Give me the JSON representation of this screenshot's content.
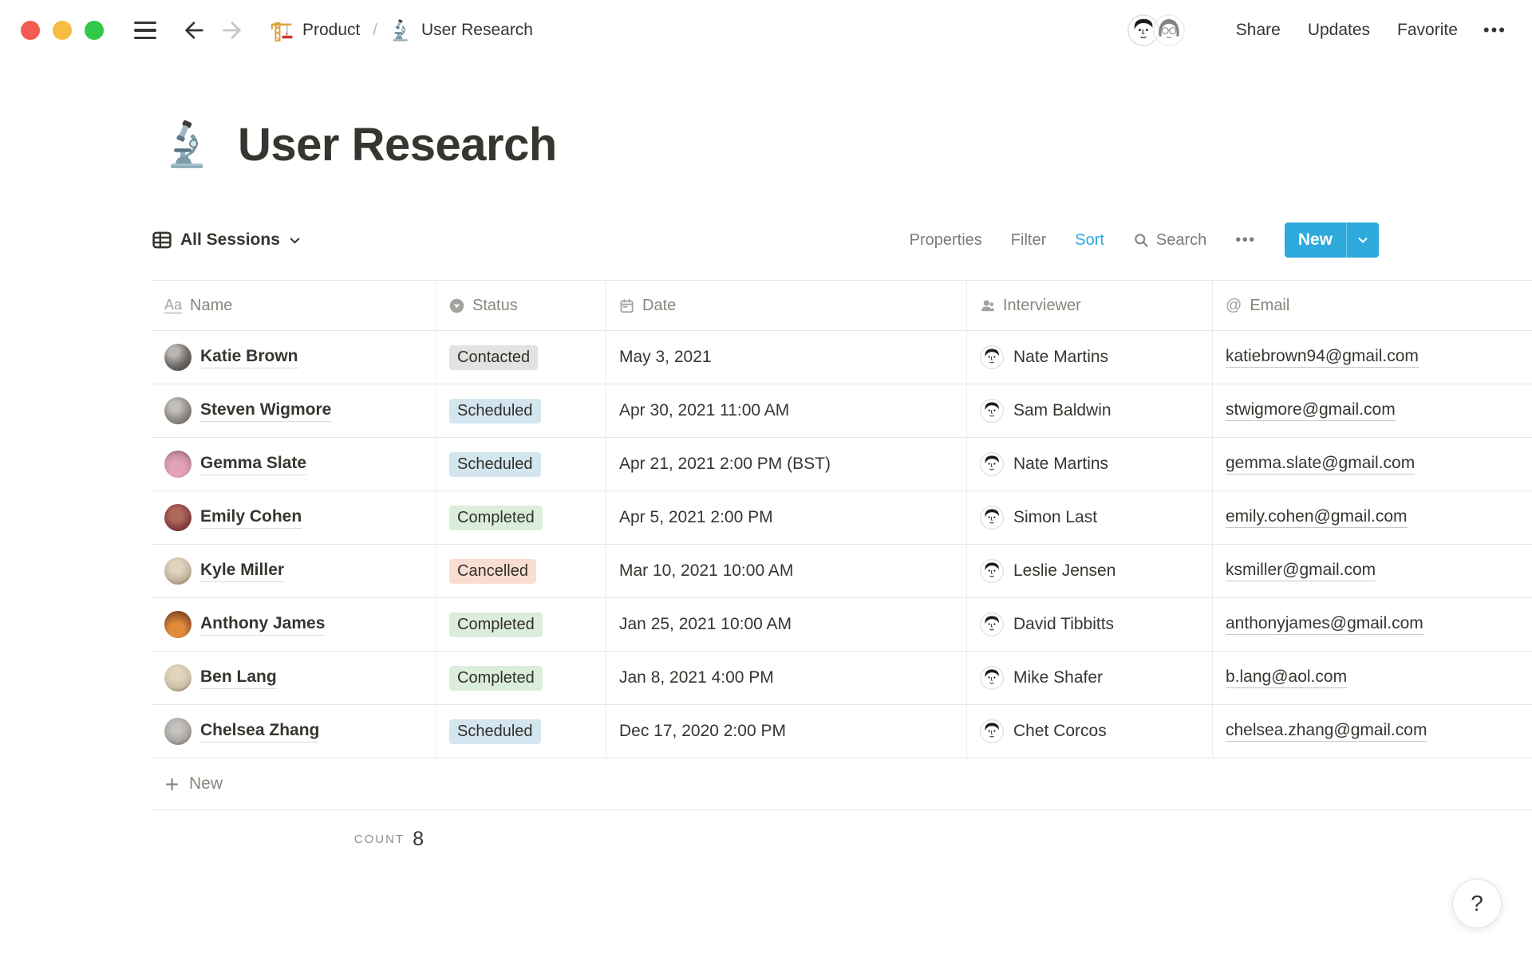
{
  "window": {
    "breadcrumb": {
      "parent": "Product",
      "separator": "/",
      "current": "User Research"
    },
    "actions": {
      "share": "Share",
      "updates": "Updates",
      "favorite": "Favorite",
      "more": "•••"
    }
  },
  "page": {
    "icon": "microscope",
    "title": "User Research"
  },
  "view_bar": {
    "view_label": "All Sessions",
    "properties": "Properties",
    "filter": "Filter",
    "sort": "Sort",
    "search": "Search",
    "more": "•••",
    "new_label": "New",
    "accent_color": "#2EAADC",
    "sort_active_color": "#2CA9E1"
  },
  "table": {
    "columns": [
      {
        "label": "Name",
        "icon": "text-icon"
      },
      {
        "label": "Status",
        "icon": "select-icon"
      },
      {
        "label": "Date",
        "icon": "calendar-icon"
      },
      {
        "label": "Interviewer",
        "icon": "person-icon"
      },
      {
        "label": "Email",
        "icon": "at-icon"
      }
    ],
    "status_colors": {
      "gray": "#E3E2E0",
      "blue": "#D3E5EF",
      "green": "#DBEDDB",
      "red": "#FADDD1"
    },
    "rows": [
      {
        "name": "Katie Brown",
        "status": "Contacted",
        "status_color": "gray",
        "date": "May 3, 2021",
        "interviewer": "Nate Martins",
        "email": "katiebrown94@gmail.com"
      },
      {
        "name": "Steven Wigmore",
        "status": "Scheduled",
        "status_color": "blue",
        "date": "Apr 30, 2021 11:00 AM",
        "interviewer": "Sam Baldwin",
        "email": "stwigmore@gmail.com"
      },
      {
        "name": "Gemma Slate",
        "status": "Scheduled",
        "status_color": "blue",
        "date": "Apr 21, 2021 2:00 PM (BST)",
        "interviewer": "Nate Martins",
        "email": "gemma.slate@gmail.com"
      },
      {
        "name": "Emily Cohen",
        "status": "Completed",
        "status_color": "green",
        "date": "Apr 5, 2021 2:00 PM",
        "interviewer": "Simon Last",
        "email": "emily.cohen@gmail.com"
      },
      {
        "name": "Kyle Miller",
        "status": "Cancelled",
        "status_color": "red",
        "date": "Mar 10, 2021 10:00 AM",
        "interviewer": "Leslie Jensen",
        "email": "ksmiller@gmail.com"
      },
      {
        "name": "Anthony James",
        "status": "Completed",
        "status_color": "green",
        "date": "Jan 25, 2021 10:00 AM",
        "interviewer": "David Tibbitts",
        "email": "anthonyjames@gmail.com"
      },
      {
        "name": "Ben Lang",
        "status": "Completed",
        "status_color": "green",
        "date": "Jan 8, 2021 4:00 PM",
        "interviewer": "Mike Shafer",
        "email": "b.lang@aol.com"
      },
      {
        "name": "Chelsea Zhang",
        "status": "Scheduled",
        "status_color": "blue",
        "date": "Dec 17, 2020 2:00 PM",
        "interviewer": "Chet Corcos",
        "email": "chelsea.zhang@gmail.com"
      }
    ],
    "new_row_label": "New",
    "footer": {
      "count_label": "COUNT",
      "count_value": "8"
    }
  },
  "help_label": "?"
}
